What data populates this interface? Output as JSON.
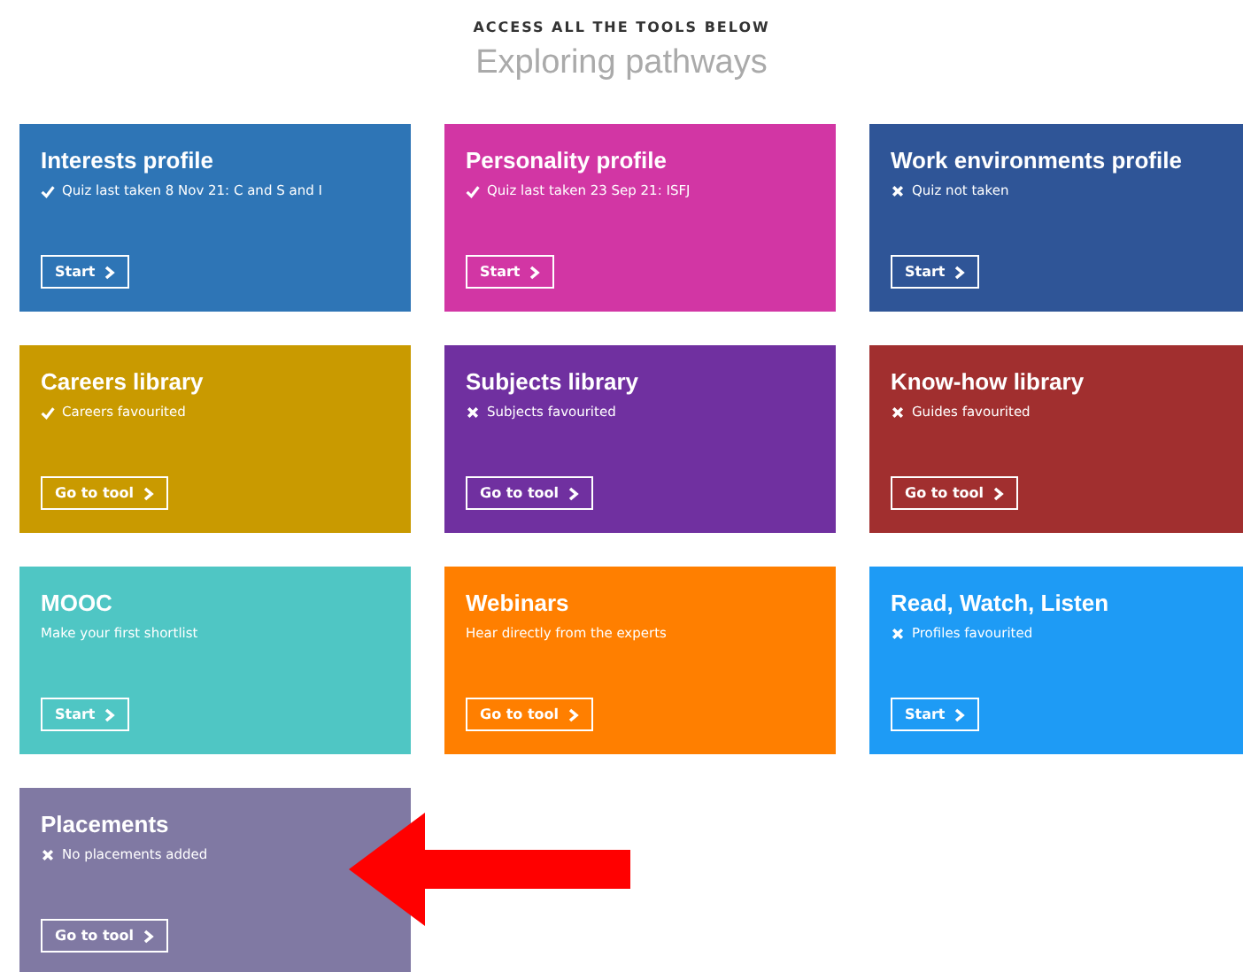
{
  "header": {
    "eyebrow": "ACCESS ALL THE TOOLS BELOW",
    "title": "Exploring pathways"
  },
  "tools": [
    {
      "title": "Interests profile",
      "status": {
        "kind": "done",
        "text": "Quiz last taken 8 Nov 21: C and S and I"
      },
      "button": "Start",
      "color": "#2e75b6"
    },
    {
      "title": "Personality profile",
      "status": {
        "kind": "done",
        "text": "Quiz last taken 23 Sep 21: ISFJ"
      },
      "button": "Start",
      "color": "#d236a4"
    },
    {
      "title": "Work environments profile",
      "status": {
        "kind": "not_done",
        "text": "Quiz not taken"
      },
      "button": "Start",
      "color": "#2f5597"
    },
    {
      "title": "Careers library",
      "status": {
        "kind": "done",
        "text": "Careers favourited"
      },
      "button": "Go to tool",
      "color": "#c99a00"
    },
    {
      "title": "Subjects library",
      "status": {
        "kind": "not_done",
        "text": "Subjects favourited"
      },
      "button": "Go to tool",
      "color": "#7030a0"
    },
    {
      "title": "Know-how library",
      "status": {
        "kind": "not_done",
        "text": "Guides favourited"
      },
      "button": "Go to tool",
      "color": "#a12f2f"
    },
    {
      "title": "MOOC",
      "status": {
        "kind": "text",
        "text": "Make your first shortlist"
      },
      "button": "Start",
      "color": "#4fc6c4"
    },
    {
      "title": "Webinars",
      "status": {
        "kind": "text",
        "text": "Hear directly from the experts"
      },
      "button": "Go to tool",
      "color": "#ff7f00"
    },
    {
      "title": "Read, Watch, Listen",
      "status": {
        "kind": "not_done",
        "text": "Profiles favourited"
      },
      "button": "Start",
      "color": "#1e9bf5"
    },
    {
      "title": "Placements",
      "status": {
        "kind": "not_done",
        "text": "No placements added"
      },
      "button": "Go to tool",
      "color": "#8079a3"
    }
  ]
}
